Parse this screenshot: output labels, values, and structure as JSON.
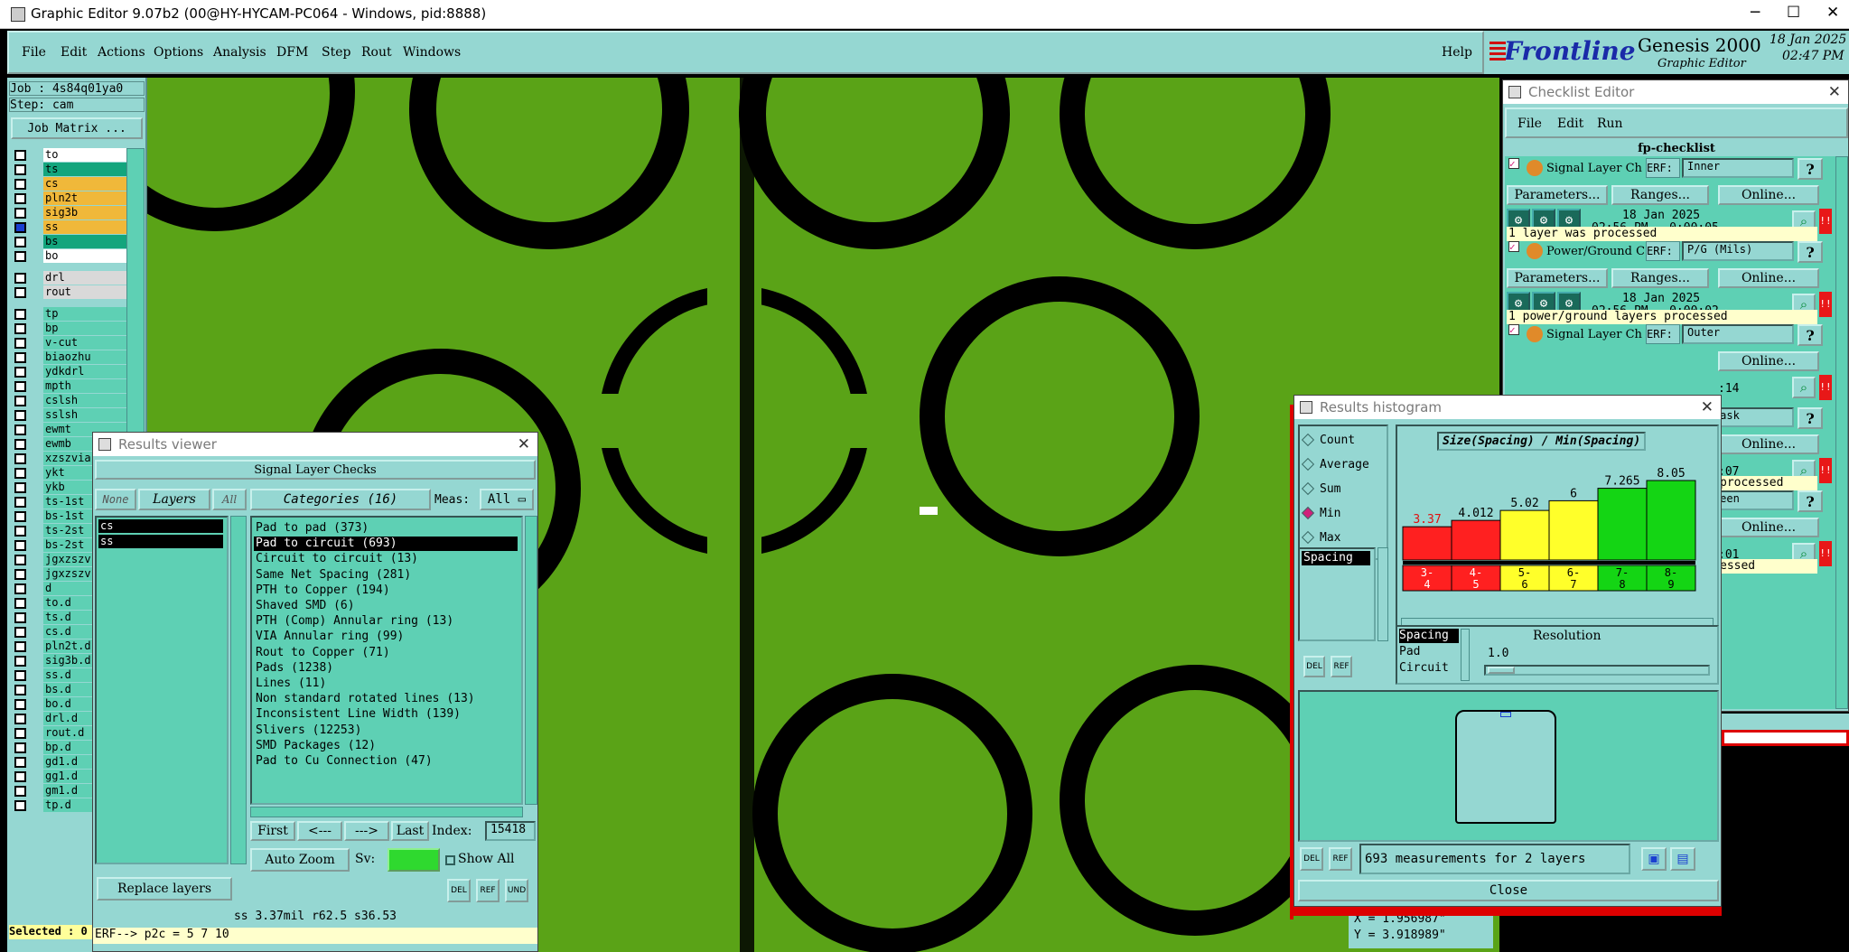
{
  "app": {
    "title": "Graphic Editor 9.07b2 (00@HY-HYCAM-PC064 - Windows, pid:8888)",
    "min": "─",
    "max": "☐",
    "close": "✕"
  },
  "menubar": {
    "items": [
      "File",
      "Edit",
      "Actions",
      "Options",
      "Analysis",
      "DFM",
      "Step",
      "Rout",
      "Windows"
    ],
    "help": "Help"
  },
  "brand": {
    "logo": "Frontline",
    "product": "Genesis 2000",
    "subtitle": "Graphic Editor",
    "date": "18 Jan 2025",
    "time": "02:47 PM"
  },
  "left": {
    "job": "Job : 4s84q01ya0",
    "step": "Step: cam",
    "matrix_btn": "Job Matrix ...",
    "layers": [
      {
        "name": "to",
        "color": "#ffffff"
      },
      {
        "name": "ts",
        "color": "#13a57d"
      },
      {
        "name": "cs",
        "color": "#f0b83a"
      },
      {
        "name": "pln2t",
        "color": "#f0b83a"
      },
      {
        "name": "sig3b",
        "color": "#f0b83a"
      },
      {
        "name": "ss",
        "color": "#f0b83a",
        "on": true
      },
      {
        "name": "bs",
        "color": "#13a57d"
      },
      {
        "name": "bo",
        "color": "#ffffff"
      },
      {
        "name": "drl",
        "color": "#d9d9d9"
      },
      {
        "name": "rout",
        "color": "#d9d9d9"
      },
      {
        "name": "tp",
        "color": "#5ed0b4"
      },
      {
        "name": "bp",
        "color": "#5ed0b4"
      },
      {
        "name": "v-cut",
        "color": "#5ed0b4"
      },
      {
        "name": "biaozhu",
        "color": "#5ed0b4"
      },
      {
        "name": "ydkdrl",
        "color": "#5ed0b4"
      },
      {
        "name": "mpth",
        "color": "#5ed0b4"
      },
      {
        "name": "cslsh",
        "color": "#5ed0b4"
      },
      {
        "name": "sslsh",
        "color": "#5ed0b4"
      },
      {
        "name": "ewmt",
        "color": "#5ed0b4"
      },
      {
        "name": "ewmb",
        "color": "#5ed0b4"
      },
      {
        "name": "xzszvia",
        "color": "#5ed0b4"
      },
      {
        "name": "ykt",
        "color": "#5ed0b4"
      },
      {
        "name": "ykb",
        "color": "#5ed0b4"
      },
      {
        "name": "ts-1st",
        "color": "#5ed0b4"
      },
      {
        "name": "bs-1st",
        "color": "#5ed0b4"
      },
      {
        "name": "ts-2st",
        "color": "#5ed0b4"
      },
      {
        "name": "bs-2st",
        "color": "#5ed0b4"
      },
      {
        "name": "jgxzszv",
        "color": "#5ed0b4"
      },
      {
        "name": "jgxzszv",
        "color": "#5ed0b4"
      },
      {
        "name": "d",
        "color": "#5ed0b4"
      },
      {
        "name": "to.d",
        "color": "#5ed0b4"
      },
      {
        "name": "ts.d",
        "color": "#5ed0b4"
      },
      {
        "name": "cs.d",
        "color": "#5ed0b4"
      },
      {
        "name": "pln2t.d",
        "color": "#5ed0b4"
      },
      {
        "name": "sig3b.d",
        "color": "#5ed0b4"
      },
      {
        "name": "ss.d",
        "color": "#5ed0b4"
      },
      {
        "name": "bs.d",
        "color": "#5ed0b4"
      },
      {
        "name": "bo.d",
        "color": "#5ed0b4"
      },
      {
        "name": "drl.d",
        "color": "#5ed0b4"
      },
      {
        "name": "rout.d",
        "color": "#5ed0b4"
      },
      {
        "name": "bp.d",
        "color": "#5ed0b4"
      },
      {
        "name": "gd1.d",
        "color": "#5ed0b4"
      },
      {
        "name": "gg1.d",
        "color": "#5ed0b4"
      },
      {
        "name": "gm1.d",
        "color": "#5ed0b4"
      },
      {
        "name": "tp.d",
        "color": "#5ed0b4"
      }
    ],
    "selected": "Selected : 0"
  },
  "rv": {
    "title": "Results viewer",
    "header": "Signal Layer Checks",
    "none": "None",
    "layers": "Layers",
    "all": "All",
    "categories": "Categories (16)",
    "meas_label": "Meas:",
    "meas_val": "All",
    "layer_list": [
      "cs",
      "ss"
    ],
    "cats": [
      "Pad to pad (373)",
      "Pad to circuit (693)",
      "Circuit to circuit (13)",
      "Same Net Spacing (281)",
      "PTH to Copper (194)",
      "Shaved SMD (6)",
      "PTH (Comp) Annular ring (13)",
      "VIA Annular ring (99)",
      "Rout to Copper (71)",
      "Pads (1238)",
      "Lines (11)",
      "Non standard rotated lines (13)",
      "Inconsistent Line Width (139)",
      "Slivers (12253)",
      "SMD Packages (12)",
      "Pad to Cu Connection (47)"
    ],
    "first": "First",
    "prev": "<---",
    "next": "--->",
    "last": "Last",
    "index_label": "Index:",
    "index_val": "15418",
    "autozoom": "Auto Zoom",
    "sv": "Sv:",
    "showall": "Show All",
    "replace": "Replace layers",
    "del": "DEL",
    "ref": "REF",
    "und": "UND",
    "status": "ss 3.37mil  r62.5  s36.53",
    "erf": "ERF--> p2c = 5 7 10"
  },
  "hist": {
    "title": "Results histogram",
    "modes": [
      "Count",
      "Average",
      "Sum",
      "Min",
      "Max"
    ],
    "selected_mode": "Min",
    "field": "Spacing",
    "chart_title": "Size(Spacing) / Min(Spacing)",
    "res_label": "Resolution",
    "res_val": "1.0",
    "res_items": [
      "Spacing",
      "Pad",
      "Circuit"
    ],
    "info": "693 measurements for 2 layers",
    "close": "Close",
    "del": "DEL",
    "ref": "REF"
  },
  "chart_data": {
    "type": "bar",
    "title": "Size(Spacing) / Min(Spacing)",
    "categories": [
      "3-4",
      "4-5",
      "5-6",
      "6-7",
      "7-8",
      "8-9"
    ],
    "values": [
      3.37,
      4.012,
      5.02,
      6,
      7.265,
      8.05
    ],
    "labels": [
      "3.37",
      "4.012",
      "5.02",
      "6",
      "7.265",
      "8.05"
    ],
    "colors": [
      "#ff2020",
      "#ff2020",
      "#ffff2a",
      "#ffff2a",
      "#14d514",
      "#14d514"
    ],
    "ylim": [
      0,
      8.05
    ]
  },
  "ce": {
    "title": "Checklist Editor",
    "menu": [
      "File",
      "Edit",
      "Run"
    ],
    "name": "fp-checklist",
    "erf": "ERF:",
    "actions": [
      {
        "name": "Signal Layer Ch",
        "erf_val": "Inner",
        "params": "Parameters...",
        "ranges": "Ranges...",
        "online": "Online...",
        "date": "18 Jan 2025",
        "time": "02:56 PM - 0:00:05",
        "msg": "1 layer was processed"
      },
      {
        "name": "Power/Ground C",
        "erf_val": "P/G (Mils)",
        "params": "Parameters...",
        "ranges": "Ranges...",
        "online": "Online...",
        "date": "18 Jan 2025",
        "time": "02:56 PM - 0:00:02",
        "msg": "1 power/ground layers processed"
      },
      {
        "name": "Signal Layer Ch",
        "erf_val": "Outer",
        "online": "Online...",
        "time": ":14"
      },
      {
        "erf_val": "ldermask",
        "online": "Online...",
        "time": ":07",
        "msg": "processed"
      },
      {
        "erf_val": "lkscreen",
        "online": "Online...",
        "time": ":01",
        "msg": "essed"
      }
    ]
  },
  "coords": {
    "x": "X = 1.956987\"",
    "y": "Y = 3.918989\""
  }
}
